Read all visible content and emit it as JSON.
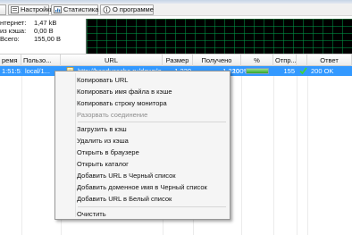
{
  "toolbar": {
    "buttons": [
      {
        "label": "Настройки",
        "icon": "settings-icon"
      },
      {
        "label": "Статистика",
        "icon": "statistics-icon"
      },
      {
        "label": "О программе",
        "icon": "info-icon"
      }
    ]
  },
  "stats": [
    {
      "label": "нтернет:",
      "value": "1,47 kB"
    },
    {
      "label": "из кэша:",
      "value": "0,00 B"
    },
    {
      "label": "Всего:",
      "value": "155,00 B"
    }
  ],
  "table": {
    "columns": [
      "ремя",
      "Пользо...",
      "URL",
      "Размер",
      "Получено",
      "%",
      "Отпр...",
      "Ответ"
    ],
    "selected_row": {
      "time": "1:51:51",
      "user": "local/1...",
      "url": "http://handycache.ru/downlo...",
      "size": "1 220",
      "received": "1 220",
      "percent": "100%",
      "progress": 1.0,
      "sent": "155",
      "response": "200 OK",
      "status_icon": "check-icon"
    }
  },
  "context_menu": {
    "items": [
      {
        "label": "Копировать URL",
        "disabled": false
      },
      {
        "label": "Копировать имя файла в кэше",
        "disabled": false
      },
      {
        "label": "Копировать строку монитора",
        "disabled": false
      },
      {
        "label": "Разорвать соединение",
        "disabled": true
      },
      {
        "label": "Загрузить в кэш",
        "disabled": false
      },
      {
        "label": "Удалить из кэша",
        "disabled": false
      },
      {
        "label": "Открыть в браузере",
        "disabled": false
      },
      {
        "label": "Открыть каталог",
        "disabled": false
      },
      {
        "label": "Добавить URL в Черный список",
        "disabled": false
      },
      {
        "label": "Добавить доменное имя в Черный список",
        "disabled": false
      },
      {
        "label": "Добавить URL в Белый список",
        "disabled": false
      },
      {
        "label": "Очистить",
        "disabled": false
      }
    ]
  },
  "colors": {
    "selection": "#3399ff",
    "graph_background": "#000000",
    "graph_grid": "#009646"
  }
}
